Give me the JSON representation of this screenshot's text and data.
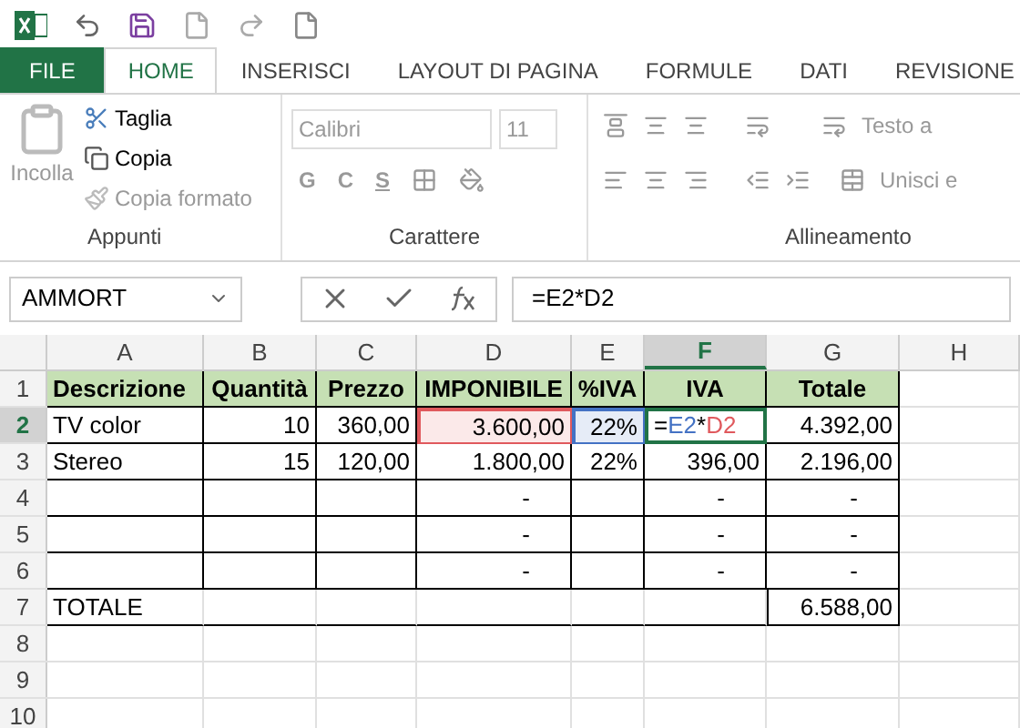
{
  "tabs": [
    {
      "label": "FILE",
      "kind": "file",
      "selected": false
    },
    {
      "label": "HOME",
      "kind": "tab",
      "selected": true
    },
    {
      "label": "INSERISCI",
      "kind": "tab",
      "selected": false
    },
    {
      "label": "LAYOUT DI PAGINA",
      "kind": "tab",
      "selected": false
    },
    {
      "label": "FORMULE",
      "kind": "tab",
      "selected": false
    },
    {
      "label": "DATI",
      "kind": "tab",
      "selected": false
    },
    {
      "label": "REVISIONE",
      "kind": "tab",
      "selected": false
    }
  ],
  "ribbon": {
    "clipboard": {
      "paste": "Incolla",
      "cut": "Taglia",
      "copy": "Copia",
      "format_painter": "Copia formato",
      "label": "Appunti"
    },
    "font": {
      "font_name": "Calibri",
      "font_size": "11",
      "bold": "G",
      "italic": "C",
      "underline": "S",
      "label": "Carattere"
    },
    "alignment": {
      "wrap_text": "Testo a",
      "merge": "Unisci e",
      "label": "Allineamento"
    }
  },
  "name_box": "AMMORT",
  "formula": "=E2*D2",
  "columns": [
    {
      "label": "A",
      "selected": false
    },
    {
      "label": "B",
      "selected": false
    },
    {
      "label": "C",
      "selected": false
    },
    {
      "label": "D",
      "selected": false
    },
    {
      "label": "E",
      "selected": false
    },
    {
      "label": "F",
      "selected": true
    },
    {
      "label": "G",
      "selected": false
    },
    {
      "label": "H",
      "selected": false
    }
  ],
  "rows": [
    {
      "number": "1",
      "kind": "header",
      "selected": false,
      "cells": [
        {
          "text": "Descrizione"
        },
        {
          "text": "Quantità"
        },
        {
          "text": "Prezzo"
        },
        {
          "text": "IMPONIBILE"
        },
        {
          "text": "%IVA"
        },
        {
          "text": "IVA"
        },
        {
          "text": "Totale"
        }
      ]
    },
    {
      "number": "2",
      "kind": "data",
      "selected": true,
      "cells": [
        {
          "text": "TV color"
        },
        {
          "text": "10"
        },
        {
          "text": "360,00"
        },
        {
          "text": "3.600,00",
          "color": "#e0595d"
        },
        {
          "text": "22%",
          "color": "#4472c4"
        },
        {
          "active": true,
          "formula_parts": [
            {
              "text": "=",
              "color": "#000000"
            },
            {
              "text": "E2",
              "color": "#4472c4"
            },
            {
              "text": "*",
              "color": "#000000"
            },
            {
              "text": "D2",
              "color": "#e0595d"
            }
          ]
        },
        {
          "text": "4.392,00"
        }
      ]
    },
    {
      "number": "3",
      "kind": "data",
      "selected": false,
      "cells": [
        {
          "text": "Stereo"
        },
        {
          "text": "15"
        },
        {
          "text": "120,00"
        },
        {
          "text": "1.800,00"
        },
        {
          "text": "22%"
        },
        {
          "text": "396,00"
        },
        {
          "text": "2.196,00"
        }
      ]
    },
    {
      "number": "4",
      "kind": "data",
      "selected": false,
      "cells": [
        {},
        {},
        {},
        {
          "text": "-",
          "kind": "dash"
        },
        {},
        {
          "text": "-",
          "kind": "dash"
        },
        {
          "text": "-",
          "kind": "dash"
        }
      ]
    },
    {
      "number": "5",
      "kind": "data",
      "selected": false,
      "cells": [
        {},
        {},
        {},
        {
          "text": "-",
          "kind": "dash"
        },
        {},
        {
          "text": "-",
          "kind": "dash"
        },
        {
          "text": "-",
          "kind": "dash"
        }
      ]
    },
    {
      "number": "6",
      "kind": "data",
      "selected": false,
      "cells": [
        {},
        {},
        {},
        {
          "text": "-",
          "kind": "dash"
        },
        {},
        {
          "text": "-",
          "kind": "dash"
        },
        {
          "text": "-",
          "kind": "dash"
        }
      ]
    },
    {
      "number": "7",
      "kind": "total",
      "selected": false,
      "cells": [
        {
          "text": "TOTALE"
        },
        {},
        {},
        {},
        {},
        {},
        {
          "text": "6.588,00"
        }
      ]
    },
    {
      "number": "8",
      "kind": "empty",
      "selected": false,
      "cells": []
    },
    {
      "number": "9",
      "kind": "empty",
      "selected": false,
      "cells": []
    },
    {
      "number": "10",
      "kind": "empty",
      "selected": false,
      "cells": []
    }
  ]
}
